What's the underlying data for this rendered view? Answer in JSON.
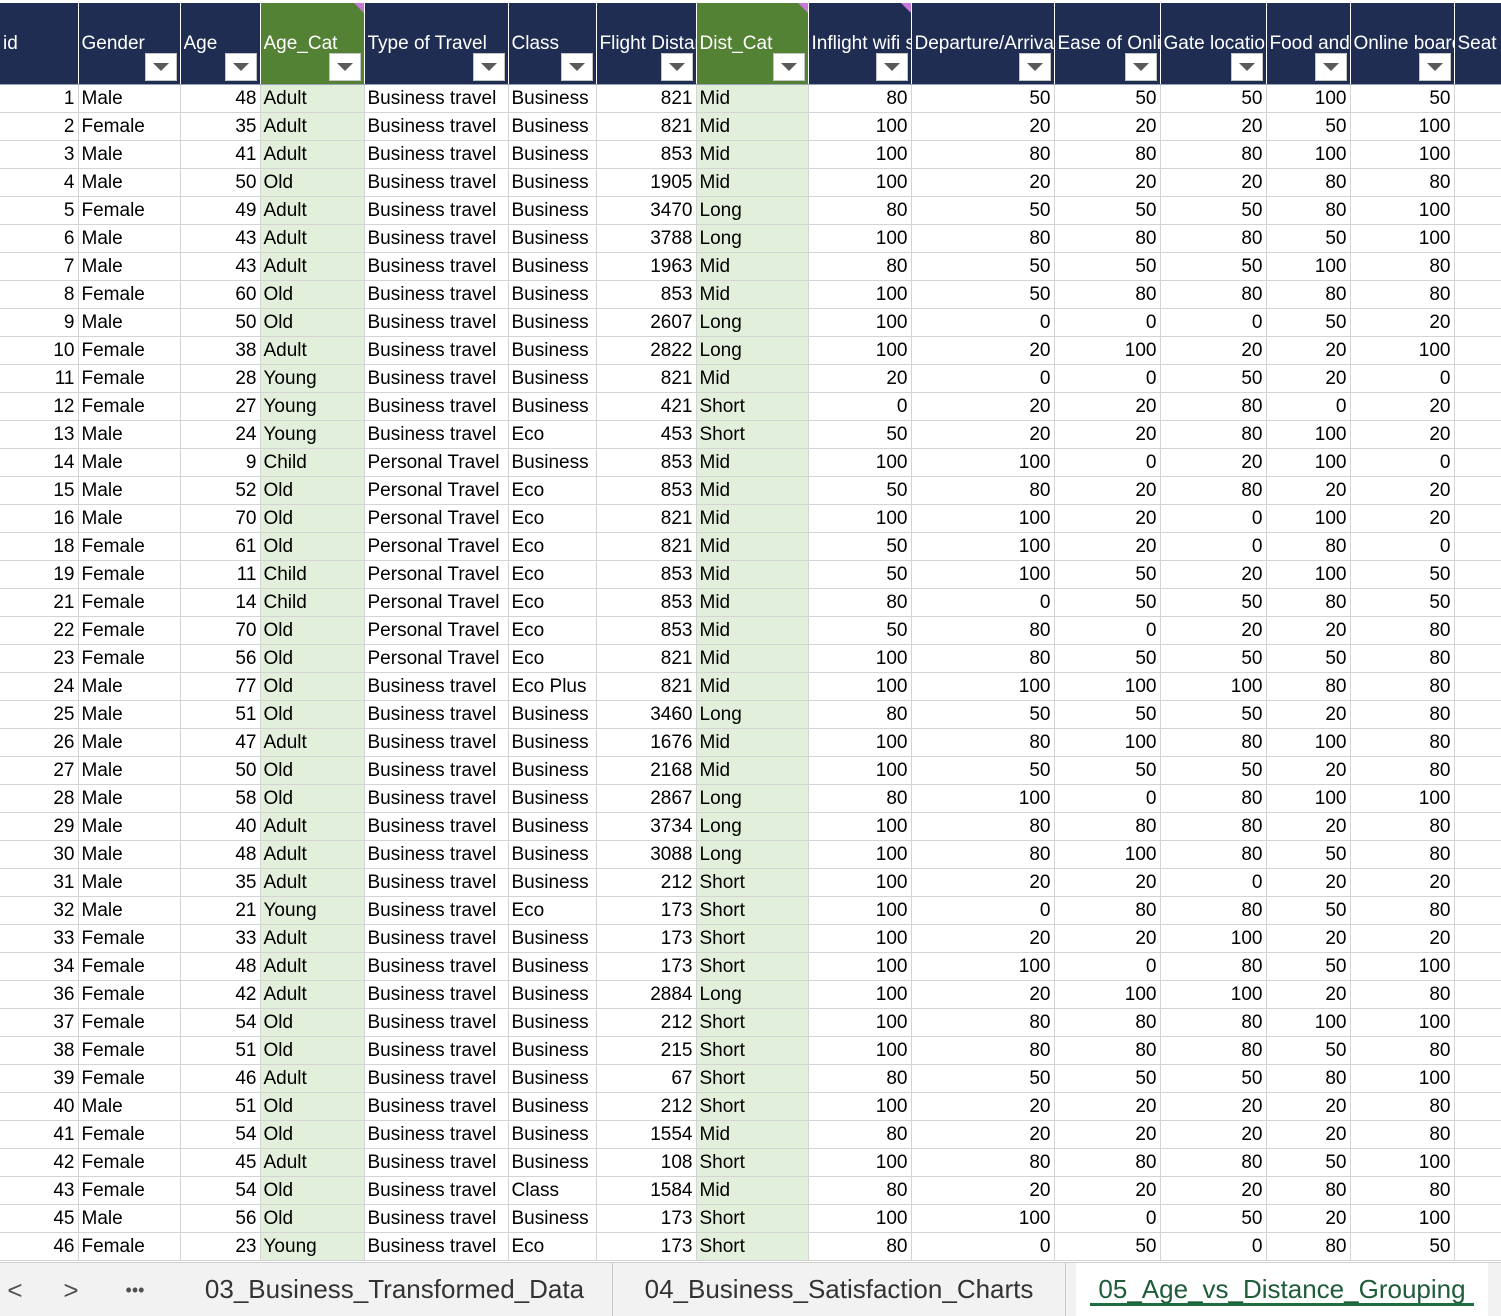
{
  "columns": [
    {
      "key": "id",
      "label": "id",
      "w": 78,
      "align": "n",
      "filter": false,
      "green": false
    },
    {
      "key": "gender",
      "label": "Gender",
      "w": 102,
      "align": "t",
      "filter": true,
      "green": false
    },
    {
      "key": "age",
      "label": "Age",
      "w": 80,
      "align": "n",
      "filter": true,
      "green": false
    },
    {
      "key": "age_cat",
      "label": "Age_Cat",
      "w": 104,
      "align": "t",
      "filter": true,
      "green": true
    },
    {
      "key": "travel",
      "label": "Type of Travel",
      "w": 144,
      "align": "t",
      "filter": true,
      "green": false
    },
    {
      "key": "class",
      "label": "Class",
      "w": 88,
      "align": "t",
      "filter": true,
      "green": false
    },
    {
      "key": "distance",
      "label": "Flight Distance",
      "w": 100,
      "align": "n",
      "filter": true,
      "green": false
    },
    {
      "key": "dist_cat",
      "label": "Dist_Cat",
      "w": 112,
      "align": "t",
      "filter": true,
      "green": true
    },
    {
      "key": "wifi",
      "label": "Inflight wifi service",
      "w": 103,
      "align": "n",
      "filter": true,
      "green": false
    },
    {
      "key": "dep_arr",
      "label": "Departure/Arrival time convenient",
      "w": 143,
      "align": "n",
      "filter": true,
      "green": false
    },
    {
      "key": "online_booking",
      "label": "Ease of Online booking",
      "w": 106,
      "align": "n",
      "filter": true,
      "green": false
    },
    {
      "key": "gate",
      "label": "Gate location",
      "w": 106,
      "align": "n",
      "filter": true,
      "green": false
    },
    {
      "key": "food",
      "label": "Food and drink",
      "w": 84,
      "align": "n",
      "filter": true,
      "green": false
    },
    {
      "key": "online_boarding",
      "label": "Online boarding",
      "w": 104,
      "align": "n",
      "filter": true,
      "green": false
    },
    {
      "key": "seat",
      "label": "Seat comfort",
      "w": 68,
      "align": "n",
      "filter": false,
      "green": false
    }
  ],
  "rows": [
    [
      "1",
      "Male",
      "48",
      "Adult",
      "Business travel",
      "Business",
      "821",
      "Mid",
      "80",
      "50",
      "50",
      "50",
      "100",
      "50"
    ],
    [
      "2",
      "Female",
      "35",
      "Adult",
      "Business travel",
      "Business",
      "821",
      "Mid",
      "100",
      "20",
      "20",
      "20",
      "50",
      "100"
    ],
    [
      "3",
      "Male",
      "41",
      "Adult",
      "Business travel",
      "Business",
      "853",
      "Mid",
      "100",
      "80",
      "80",
      "80",
      "100",
      "100"
    ],
    [
      "4",
      "Male",
      "50",
      "Old",
      "Business travel",
      "Business",
      "1905",
      "Mid",
      "100",
      "20",
      "20",
      "20",
      "80",
      "80"
    ],
    [
      "5",
      "Female",
      "49",
      "Adult",
      "Business travel",
      "Business",
      "3470",
      "Long",
      "80",
      "50",
      "50",
      "50",
      "80",
      "100"
    ],
    [
      "6",
      "Male",
      "43",
      "Adult",
      "Business travel",
      "Business",
      "3788",
      "Long",
      "100",
      "80",
      "80",
      "80",
      "50",
      "100"
    ],
    [
      "7",
      "Male",
      "43",
      "Adult",
      "Business travel",
      "Business",
      "1963",
      "Mid",
      "80",
      "50",
      "50",
      "50",
      "100",
      "80"
    ],
    [
      "8",
      "Female",
      "60",
      "Old",
      "Business travel",
      "Business",
      "853",
      "Mid",
      "100",
      "50",
      "80",
      "80",
      "80",
      "80"
    ],
    [
      "9",
      "Male",
      "50",
      "Old",
      "Business travel",
      "Business",
      "2607",
      "Long",
      "100",
      "0",
      "0",
      "0",
      "50",
      "20"
    ],
    [
      "10",
      "Female",
      "38",
      "Adult",
      "Business travel",
      "Business",
      "2822",
      "Long",
      "100",
      "20",
      "100",
      "20",
      "20",
      "100"
    ],
    [
      "11",
      "Female",
      "28",
      "Young",
      "Business travel",
      "Business",
      "821",
      "Mid",
      "20",
      "0",
      "0",
      "50",
      "20",
      "0"
    ],
    [
      "12",
      "Female",
      "27",
      "Young",
      "Business travel",
      "Business",
      "421",
      "Short",
      "0",
      "20",
      "20",
      "80",
      "0",
      "20"
    ],
    [
      "13",
      "Male",
      "24",
      "Young",
      "Business travel",
      "Eco",
      "453",
      "Short",
      "50",
      "20",
      "20",
      "80",
      "100",
      "20"
    ],
    [
      "14",
      "Male",
      "9",
      "Child",
      "Personal Travel",
      "Business",
      "853",
      "Mid",
      "100",
      "100",
      "0",
      "20",
      "100",
      "0"
    ],
    [
      "15",
      "Male",
      "52",
      "Old",
      "Personal Travel",
      "Eco",
      "853",
      "Mid",
      "50",
      "80",
      "20",
      "80",
      "20",
      "20"
    ],
    [
      "16",
      "Male",
      "70",
      "Old",
      "Personal Travel",
      "Eco",
      "821",
      "Mid",
      "100",
      "100",
      "20",
      "0",
      "100",
      "20"
    ],
    [
      "18",
      "Female",
      "61",
      "Old",
      "Personal Travel",
      "Eco",
      "821",
      "Mid",
      "50",
      "100",
      "20",
      "0",
      "80",
      "0"
    ],
    [
      "19",
      "Female",
      "11",
      "Child",
      "Personal Travel",
      "Eco",
      "853",
      "Mid",
      "50",
      "100",
      "50",
      "20",
      "100",
      "50"
    ],
    [
      "21",
      "Female",
      "14",
      "Child",
      "Personal Travel",
      "Eco",
      "853",
      "Mid",
      "80",
      "0",
      "50",
      "50",
      "80",
      "50"
    ],
    [
      "22",
      "Female",
      "70",
      "Old",
      "Personal Travel",
      "Eco",
      "853",
      "Mid",
      "50",
      "80",
      "0",
      "20",
      "20",
      "80"
    ],
    [
      "23",
      "Female",
      "56",
      "Old",
      "Personal Travel",
      "Eco",
      "821",
      "Mid",
      "100",
      "80",
      "50",
      "50",
      "50",
      "80"
    ],
    [
      "24",
      "Male",
      "77",
      "Old",
      "Business travel",
      "Eco Plus",
      "821",
      "Mid",
      "100",
      "100",
      "100",
      "100",
      "80",
      "80"
    ],
    [
      "25",
      "Male",
      "51",
      "Old",
      "Business travel",
      "Business",
      "3460",
      "Long",
      "80",
      "50",
      "50",
      "50",
      "20",
      "80"
    ],
    [
      "26",
      "Male",
      "47",
      "Adult",
      "Business travel",
      "Business",
      "1676",
      "Mid",
      "100",
      "80",
      "100",
      "80",
      "100",
      "80"
    ],
    [
      "27",
      "Male",
      "50",
      "Old",
      "Business travel",
      "Business",
      "2168",
      "Mid",
      "100",
      "50",
      "50",
      "50",
      "20",
      "80"
    ],
    [
      "28",
      "Male",
      "58",
      "Old",
      "Business travel",
      "Business",
      "2867",
      "Long",
      "80",
      "100",
      "0",
      "80",
      "100",
      "100"
    ],
    [
      "29",
      "Male",
      "40",
      "Adult",
      "Business travel",
      "Business",
      "3734",
      "Long",
      "100",
      "80",
      "80",
      "80",
      "20",
      "80"
    ],
    [
      "30",
      "Male",
      "48",
      "Adult",
      "Business travel",
      "Business",
      "3088",
      "Long",
      "100",
      "80",
      "100",
      "80",
      "50",
      "80"
    ],
    [
      "31",
      "Male",
      "35",
      "Adult",
      "Business travel",
      "Business",
      "212",
      "Short",
      "100",
      "20",
      "20",
      "0",
      "20",
      "20"
    ],
    [
      "32",
      "Male",
      "21",
      "Young",
      "Business travel",
      "Eco",
      "173",
      "Short",
      "100",
      "0",
      "80",
      "80",
      "50",
      "80"
    ],
    [
      "33",
      "Female",
      "33",
      "Adult",
      "Business travel",
      "Business",
      "173",
      "Short",
      "100",
      "20",
      "20",
      "100",
      "20",
      "20"
    ],
    [
      "34",
      "Female",
      "48",
      "Adult",
      "Business travel",
      "Business",
      "173",
      "Short",
      "100",
      "100",
      "0",
      "80",
      "50",
      "100"
    ],
    [
      "36",
      "Female",
      "42",
      "Adult",
      "Business travel",
      "Business",
      "2884",
      "Long",
      "100",
      "20",
      "100",
      "100",
      "20",
      "80"
    ],
    [
      "37",
      "Female",
      "54",
      "Old",
      "Business travel",
      "Business",
      "212",
      "Short",
      "100",
      "80",
      "80",
      "80",
      "100",
      "100"
    ],
    [
      "38",
      "Female",
      "51",
      "Old",
      "Business travel",
      "Business",
      "215",
      "Short",
      "100",
      "80",
      "80",
      "80",
      "50",
      "80"
    ],
    [
      "39",
      "Female",
      "46",
      "Adult",
      "Business travel",
      "Business",
      "67",
      "Short",
      "80",
      "50",
      "50",
      "50",
      "80",
      "100"
    ],
    [
      "40",
      "Male",
      "51",
      "Old",
      "Business travel",
      "Business",
      "212",
      "Short",
      "100",
      "20",
      "20",
      "20",
      "20",
      "80"
    ],
    [
      "41",
      "Female",
      "54",
      "Old",
      "Business travel",
      "Business",
      "1554",
      "Mid",
      "80",
      "20",
      "20",
      "20",
      "20",
      "80"
    ],
    [
      "42",
      "Female",
      "45",
      "Adult",
      "Business travel",
      "Business",
      "108",
      "Short",
      "100",
      "80",
      "80",
      "80",
      "50",
      "100"
    ],
    [
      "43",
      "Female",
      "54",
      "Old",
      "Business travel",
      "Class",
      "1584",
      "Mid",
      "80",
      "20",
      "20",
      "20",
      "80",
      "80"
    ],
    [
      "45",
      "Male",
      "56",
      "Old",
      "Business travel",
      "Business",
      "173",
      "Short",
      "100",
      "100",
      "0",
      "50",
      "20",
      "100"
    ],
    [
      "46",
      "Female",
      "23",
      "Young",
      "Business travel",
      "Eco",
      "173",
      "Short",
      "80",
      "0",
      "50",
      "0",
      "80",
      "50"
    ]
  ],
  "tabs": {
    "prev": "<",
    "next": ">",
    "more": "•••",
    "sheet1": "03_Business_Transformed_Data",
    "sheet2": "04_Business_Satisfaction_Charts",
    "sheet3": "05_Age_vs_Distance_Grouping"
  }
}
